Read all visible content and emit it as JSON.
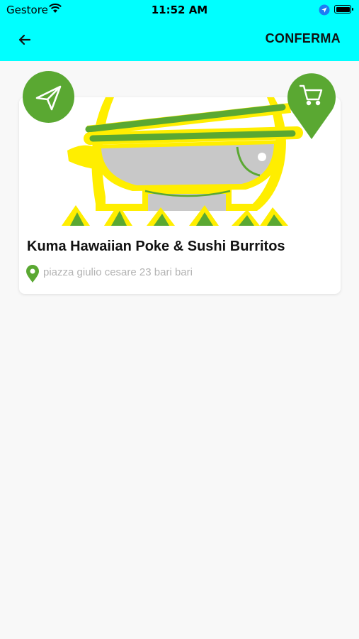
{
  "status_bar": {
    "carrier": "Gestore",
    "time": "11:52 AM"
  },
  "header": {
    "confirm_label": "CONFERMA"
  },
  "restaurant": {
    "name": "Kuma Hawaiian Poke & Sushi Burritos",
    "address": "piazza giulio cesare 23 bari bari"
  },
  "icons": {
    "back": "arrow-left-icon",
    "send": "paper-plane-icon",
    "cart": "shopping-cart-icon",
    "location": "location-pin-icon"
  },
  "colors": {
    "header_bg": "#00ffff",
    "accent_green": "#5aa832",
    "logo_yellow": "#ffee00"
  }
}
